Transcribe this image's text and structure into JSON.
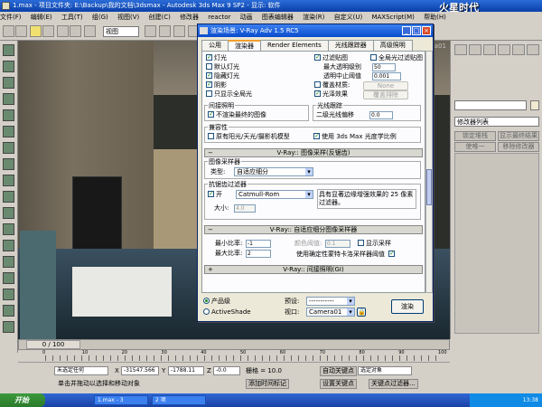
{
  "window": {
    "title": "1.max    - 项目文件夹: E:\\Backup\\我的文档\\3dsmax    - Autodesk 3ds Max 9 SP2    - 显示: 软件"
  },
  "menu": [
    "文件(F)",
    "编辑(E)",
    "工具(T)",
    "组(G)",
    "视图(V)",
    "创建(C)",
    "修改器",
    "reactor",
    "动画",
    "图表编辑器",
    "渲染(R)",
    "自定义(U)",
    "MAXScript(M)",
    "帮助(H)"
  ],
  "toolbar": {
    "view_select": "视图"
  },
  "viewport": {
    "label": "Camera01"
  },
  "command_panel": {
    "modifier_list": "修改器列表",
    "btn1a": "锁定堆栈",
    "btn1b": "显示最终结果",
    "btn2a": "使唯一",
    "btn2b": "移除修改器"
  },
  "dialog": {
    "title": "渲染场景: V-Ray Adv 1.5 RC5",
    "tabs": [
      "公用",
      "渲染器",
      "Render Elements",
      "光线跟踪器",
      "高级照明"
    ],
    "global_switches": {
      "lights": "灯光",
      "default_lights": "默认灯光",
      "hidden_lights": "隐藏灯光",
      "shadows": "阴影",
      "show_gi_only": "只显示全局光",
      "filter_maps": "过滤贴图",
      "filter_gi": "全局光过滤贴图",
      "max_transp_label": "最大透明级别",
      "max_transp_value": "50",
      "transp_cutoff_label": "透明中止阈值",
      "transp_cutoff_value": "0.001",
      "override_mtl": "覆盖材质:",
      "override_btn": "None",
      "glossy_effects": "光泽效果",
      "override_exclude": "覆盖排除"
    },
    "indirect": {
      "title": "间接照明",
      "dont_render_final": "不渲染最终的图像"
    },
    "raytracing": {
      "title": "光线跟踪",
      "secondary_bias_label": "二级光线偏移",
      "secondary_bias_value": "0.0"
    },
    "compat": {
      "title": "兼容性",
      "legacy": "原有阳光/天光/摄影机模型",
      "use_units": "使用 3ds Max 光度学比例"
    },
    "image_sampler": {
      "rollout": "V-Ray:: 图像采样(反锯齿)",
      "sampler_group": "图像采样器",
      "type_label": "类型:",
      "type_value": "自适应细分",
      "aa_group": "抗锯齿过滤器",
      "aa_on": "开",
      "aa_filter": "Catmull-Rom",
      "aa_desc": "具有显著边缘增强效果的 25 像素过滤器。",
      "size_label": "大小:",
      "size_value": "4.0"
    },
    "adaptive": {
      "rollout": "V-Ray:: 自适应细分图像采样器",
      "min_rate_label": "最小比率:",
      "min_rate_value": "-1",
      "max_rate_label": "最大比率:",
      "max_rate_value": "2",
      "clr_thresh_label": "颜色阈值:",
      "clr_thresh_value": "0.1",
      "show_samples": "显示采样",
      "use_dmc": "使用确定性蒙特卡洛采样器阈值"
    },
    "gi_rollout": "V-Ray:: 间接照明(GI)",
    "bottom": {
      "product": "产品级",
      "activeshade": "ActiveShade",
      "preset_label": "预设:",
      "preset_value": "-----------",
      "viewport_label": "视口:",
      "viewport_value": "Camera01",
      "render_btn": "渲染"
    }
  },
  "timeline": {
    "frame": "0 / 100",
    "ticks": [
      "0",
      "10",
      "20",
      "30",
      "40",
      "50",
      "60",
      "70",
      "80",
      "90",
      "100"
    ]
  },
  "status": {
    "selected": "未选定任何",
    "hint": "单击并拖动以选择和移动对象",
    "x_label": "X",
    "x_value": "-31547.566",
    "y_label": "Y",
    "y_value": "-1788.11",
    "z_label": "Z",
    "z_value": "-0.0",
    "grid": "栅格 = 10.0",
    "add_tag": "添加时间标记",
    "auto_key": "自动关键点",
    "set_key": "设置关键点",
    "sel_obj": "选定对象",
    "key_filters": "关键点过滤器..."
  },
  "taskbar": {
    "start": "开始",
    "tasks": [
      "1.max - 3",
      "2 项"
    ],
    "clock": "13:38"
  },
  "watermark": "火星时代"
}
